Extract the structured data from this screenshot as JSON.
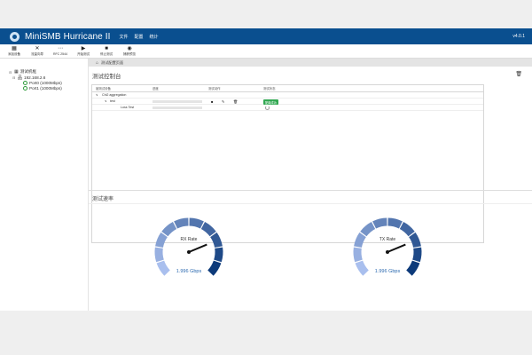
{
  "header": {
    "app_title": "MiniSMB Hurricane II",
    "menu": [
      "文件",
      "配置",
      "统计"
    ],
    "version": "v4.0.1"
  },
  "toolbar": {
    "items": [
      {
        "label": "添加设备",
        "icon": "grid-icon"
      },
      {
        "label": "流量向导",
        "icon": "shuffle-icon"
      },
      {
        "label": "RFC 2544",
        "icon": "rfc-icon"
      },
      {
        "label": "开始测试",
        "icon": "play-icon"
      },
      {
        "label": "停止测试",
        "icon": "stop-icon"
      },
      {
        "label": "捕获预览",
        "icon": "eye-icon"
      }
    ]
  },
  "sidebar": {
    "root_label": "测试机框",
    "device_label": "192.168.2.6",
    "ports": [
      "Port0 (1000Mbps)",
      "Port1 (1000Mbps)"
    ]
  },
  "main": {
    "breadcrumb": "测试配置页面",
    "console_title": "测试控制台",
    "table": {
      "headers": [
        "被测试设备",
        "进度",
        "测试动作",
        "测试状态"
      ],
      "group_label": "Chi2 aggregation",
      "test_label": "test",
      "sub_label": "Loss Test",
      "status_badge": "配置成功"
    },
    "rate_title": "测试速率",
    "gauges": [
      {
        "label": "RX Rate",
        "value_text": "1.996 Gbps",
        "level": 0.75
      },
      {
        "label": "TX Rate",
        "value_text": "1.996 Gbps",
        "level": 0.75
      }
    ]
  },
  "colors": {
    "header_bg": "#0a4f8f",
    "gauge_light": "#a9bfee",
    "gauge_dark": "#0d3a7a",
    "status_green": "#32a852",
    "value_text": "#2c6ab0"
  }
}
